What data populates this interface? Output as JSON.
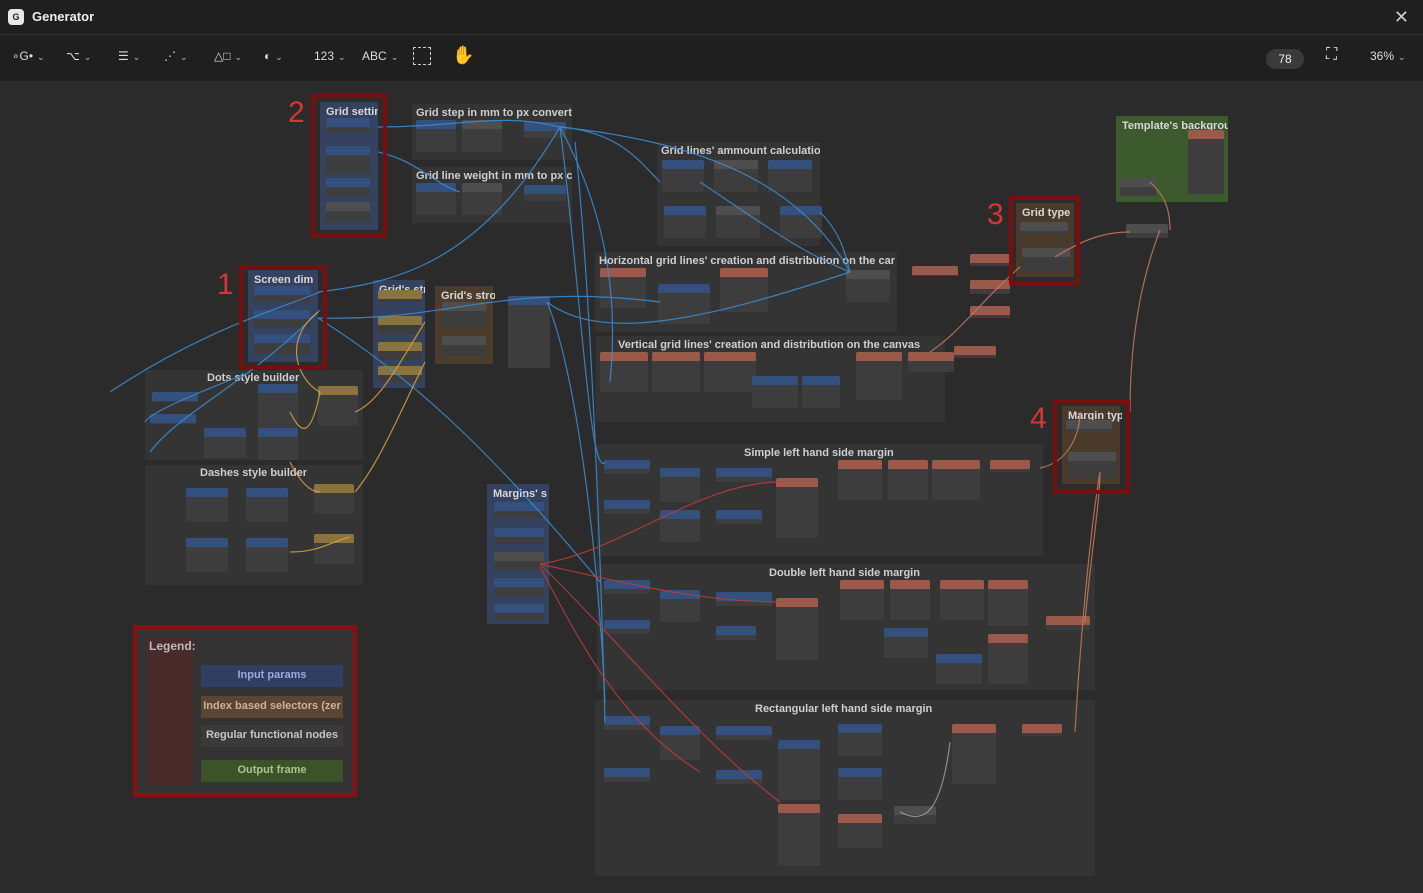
{
  "window": {
    "title": "Generator",
    "app_icon_text": "G"
  },
  "toolbar": {
    "tools": [
      {
        "name": "layers-tool",
        "label": "∘G•"
      },
      {
        "name": "share-tool",
        "label": "⌥"
      },
      {
        "name": "list-tool",
        "label": "☰"
      },
      {
        "name": "curve-tool",
        "label": "⋰"
      },
      {
        "name": "shapes-tool",
        "label": "△□"
      },
      {
        "name": "palette-tool",
        "label": "◐"
      },
      {
        "name": "number-tool",
        "label": "123"
      },
      {
        "name": "text-tool",
        "label": "ABC"
      }
    ],
    "node_count": "78",
    "zoom": "36%"
  },
  "markers": {
    "m1": "1",
    "m2": "2",
    "m3": "3",
    "m4": "4"
  },
  "groups": {
    "grid_settings": "Grid settin",
    "grid_step": "Grid step in mm to px converti",
    "grid_weight": "Grid line weight in mm to px co",
    "grid_amount": "Grid lines' ammount calculatio",
    "horizontal": "Horizontal grid lines' creation and distribution on the car",
    "vertical": "Vertical grid lines' creation and distribution on the canvas",
    "screen_dims": "Screen dim",
    "grid_str": "Grid's str",
    "grid_str2": "Grid's stro",
    "dots_builder": "Dots style builder",
    "dashes_builder": "Dashes style builder",
    "margins_settings": "Margins' s",
    "simple_margin": "Simple left hand side margin",
    "double_margin": "Double left hand side margin",
    "rect_margin": "Rectangular left hand side margin",
    "template_bg": "Template's backgrou",
    "grid_type": "Grid type",
    "margin_type": "Margin typ"
  },
  "legend": {
    "title": "Legend:",
    "items": [
      {
        "label": "Input params",
        "color": "#2f3e63",
        "text_color": "#9aaad6"
      },
      {
        "label": "Index based selectors (zer",
        "color": "#5a4632",
        "text_color": "#c9b49a"
      },
      {
        "label": "Regular functional nodes",
        "color": "#3a3a3a",
        "text_color": "#c5c5c5"
      },
      {
        "label": "Output frame",
        "color": "#3c5228",
        "text_color": "#a9c48c"
      }
    ]
  },
  "colors": {
    "input_node": "#34507d",
    "selector_node": "#8a7340",
    "func_node": "#4e4e4e",
    "output_node": "#9a5a4a",
    "highlight": "#7a0d0d",
    "wire_blue": "#3b8fd6",
    "wire_orange": "#d9a441",
    "wire_red": "#c23b3b"
  }
}
